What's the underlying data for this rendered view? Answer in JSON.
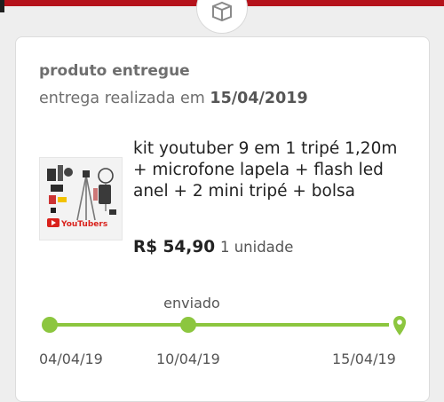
{
  "order": {
    "status": "produto entregue",
    "delivery_prefix": "entrega realizada em",
    "delivery_date": "15/04/2019"
  },
  "product": {
    "name": "kit youtuber 9 em 1 tripé 1,20m + microfone lapela + flash led anel + 2 mini tripé + bolsa",
    "price": "R$ 54,90",
    "quantity": "1 unidade",
    "image_text": "YouTubers"
  },
  "timeline": {
    "middle_label": "enviado",
    "dates": [
      "04/04/19",
      "10/04/19",
      "15/04/19"
    ],
    "progress": 1.0
  },
  "colors": {
    "accent_red": "#b5121b",
    "progress_green": "#8cc63f",
    "text_gray": "#6e6e6e"
  },
  "icons": {
    "top": "package-box-icon",
    "end_marker": "location-pin-icon"
  }
}
